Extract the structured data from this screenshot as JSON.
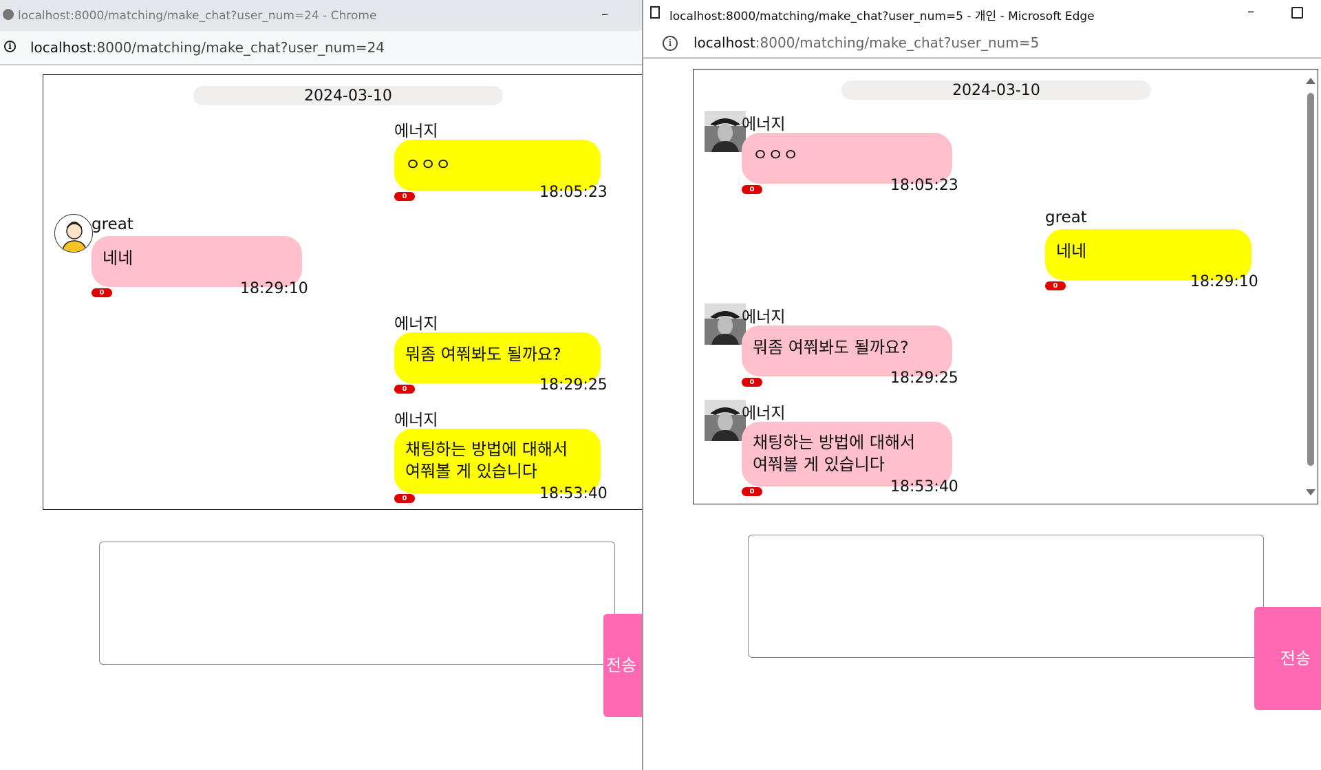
{
  "left_window": {
    "title": "localhost:8000/matching/make_chat?user_num=24 - Chrome",
    "url_host": "localhost",
    "url_rest": ":8000/matching/make_chat?user_num=24",
    "minimize_icon": "minimize-icon",
    "date": "2024-03-10",
    "messages": [
      {
        "sender": "에너지",
        "lines": [
          "ㅇㅇㅇ"
        ],
        "time": "18:05:23",
        "unread": "0",
        "side": "right",
        "color": "#ffff00"
      },
      {
        "sender": "great",
        "lines": [
          "네네"
        ],
        "time": "18:29:10",
        "unread": "0",
        "side": "left",
        "color": "#ffc0cb",
        "avatar": "user-avatar-icon"
      },
      {
        "sender": "에너지",
        "lines": [
          "뭐좀 여쭤봐도 될까요?"
        ],
        "time": "18:29:25",
        "unread": "0",
        "side": "right",
        "color": "#ffff00"
      },
      {
        "sender": "에너지",
        "lines": [
          "채팅하는 방법에 대해서",
          "여쭤볼 게 있습니다"
        ],
        "time": "18:53:40",
        "unread": "0",
        "side": "right",
        "color": "#ffff00"
      }
    ],
    "input_value": "",
    "send_label": "전송"
  },
  "right_window": {
    "title": "localhost:8000/matching/make_chat?user_num=5 - 개인 - Microsoft Edge",
    "url_host": "localhost",
    "url_rest": ":8000/matching/make_chat?user_num=5",
    "date": "2024-03-10",
    "messages": [
      {
        "sender": "에너지",
        "lines": [
          "ㅇㅇㅇ"
        ],
        "time": "18:05:23",
        "unread": "0",
        "side": "left",
        "color": "#ffc0cb",
        "avatar": "profile-photo"
      },
      {
        "sender": "great",
        "lines": [
          "네네"
        ],
        "time": "18:29:10",
        "unread": "0",
        "side": "right",
        "color": "#ffff00"
      },
      {
        "sender": "에너지",
        "lines": [
          "뭐좀 여쭤봐도 될까요?"
        ],
        "time": "18:29:25",
        "unread": "0",
        "side": "left",
        "color": "#ffc0cb",
        "avatar": "profile-photo"
      },
      {
        "sender": "에너지",
        "lines": [
          "채팅하는 방법에 대해서",
          "여쭤볼 게 있습니다"
        ],
        "time": "18:53:40",
        "unread": "0",
        "side": "left",
        "color": "#ffc0cb",
        "avatar": "profile-photo"
      }
    ],
    "input_value": "",
    "send_label": "전송"
  },
  "colors": {
    "mine_bubble": "#ffff00",
    "other_bubble": "#ffc0cb",
    "send_button": "#ff69b4",
    "unread_badge": "#e00000"
  }
}
